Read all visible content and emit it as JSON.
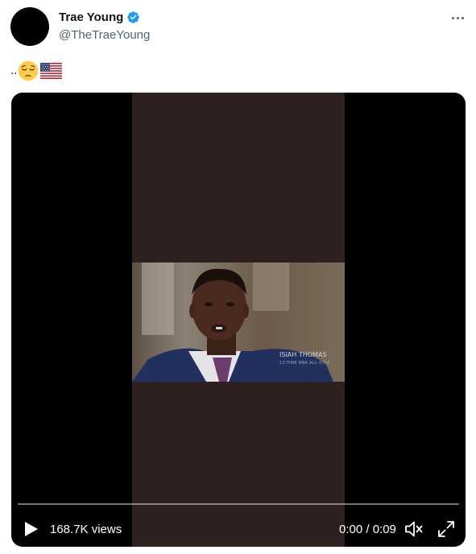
{
  "author": {
    "display_name": "Trae Young",
    "handle": "@TheTraeYoung",
    "verified": true,
    "avatar_color": "#000000",
    "verified_color": "#1d9bf0"
  },
  "tweet": {
    "prefix_text": "..",
    "emojis": [
      "pensive-face-emoji",
      "us-flag-emoji"
    ]
  },
  "video": {
    "caption_name": "ISIAH THOMAS",
    "caption_sub": "12-TIME NBA ALL-STAR",
    "views": "168.7K views",
    "time": "0:00 / 0:09",
    "progress": 0
  },
  "icons": {
    "more": "more-horizontal-icon",
    "play": "play-icon",
    "volume": "volume-muted-icon",
    "fullscreen": "fullscreen-icon"
  }
}
